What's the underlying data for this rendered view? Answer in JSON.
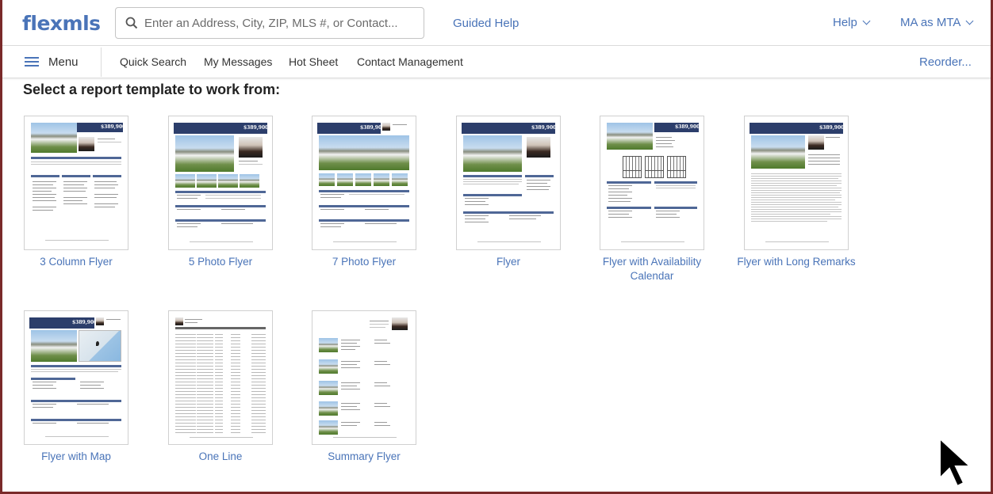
{
  "header": {
    "logo": "flexmls",
    "search_placeholder": "Enter an Address, City, ZIP, MLS #, or Contact...",
    "guided_help": "Guided Help",
    "help": "Help",
    "user": "MA as MTA"
  },
  "nav": {
    "menu": "Menu",
    "links": [
      "Quick Search",
      "My Messages",
      "Hot Sheet",
      "Contact Management"
    ],
    "reorder": "Reorder..."
  },
  "content": {
    "heading": "Select a report template to work from:",
    "templates": [
      {
        "label": "3 Column Flyer"
      },
      {
        "label": "5 Photo Flyer"
      },
      {
        "label": "7 Photo Flyer"
      },
      {
        "label": "Flyer"
      },
      {
        "label": "Flyer with Availability Calendar"
      },
      {
        "label": "Flyer with Long Remarks"
      },
      {
        "label": "Flyer with Map"
      },
      {
        "label": "One Line"
      },
      {
        "label": "Summary Flyer"
      }
    ]
  },
  "thumbnail_price": "$389,900",
  "colors": {
    "accent": "#4a74b8",
    "thumbnail_header": "#2c3e6b",
    "background": "#7a2a2a"
  }
}
